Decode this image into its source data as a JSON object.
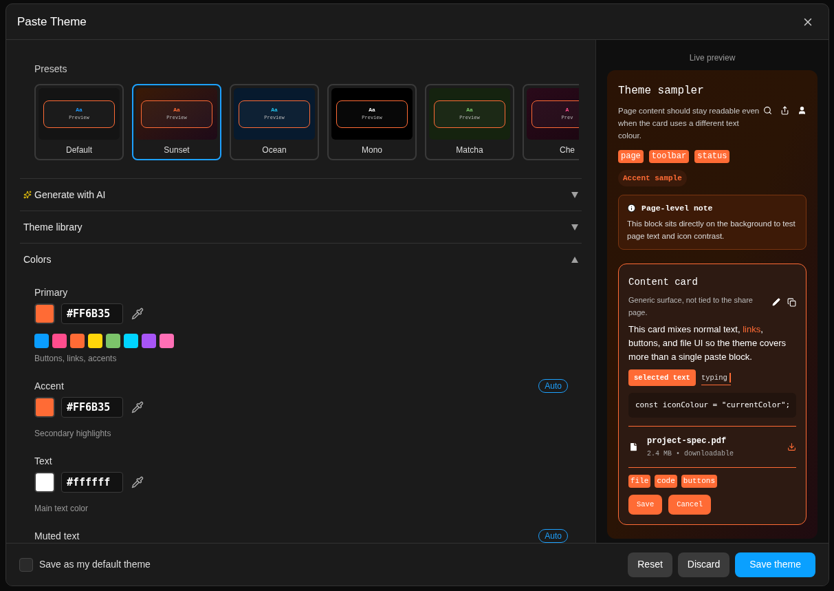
{
  "dialog": {
    "title": "Paste Theme"
  },
  "presets": {
    "label": "Presets",
    "items": [
      {
        "name": "Default",
        "sample": "Aa",
        "preview": "Preview",
        "kind": "default",
        "color": "#1e9bff",
        "selected": false
      },
      {
        "name": "Sunset",
        "sample": "Aa",
        "preview": "Preview",
        "kind": "sunset",
        "color": "#ff6b35",
        "selected": true
      },
      {
        "name": "Ocean",
        "sample": "Aa",
        "preview": "Preview",
        "kind": "ocean",
        "color": "#22c3ee",
        "selected": false
      },
      {
        "name": "Mono",
        "sample": "Aa",
        "preview": "Preview",
        "kind": "mono",
        "color": "#ffffff",
        "selected": false
      },
      {
        "name": "Matcha",
        "sample": "Aa",
        "preview": "Preview",
        "kind": "matcha",
        "color": "#7cc46a",
        "selected": false
      },
      {
        "name": "Che",
        "sample": "A",
        "preview": "Prev",
        "kind": "cherry",
        "color": "#ff4d8d",
        "selected": false
      }
    ]
  },
  "sections": [
    {
      "title": "Generate with AI",
      "kind": "ai",
      "expanded": false
    },
    {
      "title": "Theme library",
      "kind": "plain",
      "expanded": false
    },
    {
      "title": "Colors",
      "kind": "plain",
      "expanded": true
    }
  ],
  "colors": [
    {
      "label": "Primary",
      "value": "#FF6B35",
      "color": "#ff6b35",
      "hint": "Buttons, links, accents",
      "palette": [
        {
          "color": "#0a9dff"
        },
        {
          "color": "#ff4d8d"
        },
        {
          "color": "#ff6b35"
        },
        {
          "color": "#ffd60a"
        },
        {
          "color": "#7cc46a"
        },
        {
          "color": "#00d4ff"
        },
        {
          "color": "#a855f7"
        },
        {
          "color": "#ff6fb5"
        }
      ]
    },
    {
      "label": "Accent",
      "badge": "Auto",
      "value": "#FF6B35",
      "color": "#ff6b35",
      "hint": "Secondary highlights"
    },
    {
      "label": "Text",
      "value": "#ffffff",
      "color": "#ffffff",
      "hint": "Main text color"
    },
    {
      "label": "Muted text",
      "badge": "Auto"
    }
  ],
  "preview": {
    "label": "Live preview",
    "title": "Theme sampler",
    "description": "Page content should stay readable even when the card uses a different text colour.",
    "tags": [
      "page",
      "toolbar",
      "status"
    ],
    "accent": "Accent sample",
    "note": {
      "title": "Page-level note",
      "body": "This block sits directly on the background to test page text and icon contrast."
    },
    "card": {
      "title": "Content card",
      "subtitle": "Generic surface, not tied to the share page.",
      "body_before": "This card mixes normal text, ",
      "link": "links",
      "body_after": ", buttons, and file UI so the theme covers more than a single paste block.",
      "selected": "selected text",
      "typing": "typing",
      "code": "const iconColour = \"currentColor\";",
      "file": {
        "name": "project-spec.pdf",
        "meta": "2.4 MB • downloadable"
      },
      "tags": [
        "file",
        "code",
        "buttons"
      ],
      "buttons": [
        "Save",
        "Cancel"
      ]
    }
  },
  "footer": {
    "checkbox": {
      "label": "Save as my default theme",
      "checked": false
    },
    "buttons": [
      {
        "label": "Reset",
        "kind": "secondary"
      },
      {
        "label": "Discard",
        "kind": "secondary"
      },
      {
        "label": "Save theme",
        "kind": "primary"
      }
    ]
  }
}
